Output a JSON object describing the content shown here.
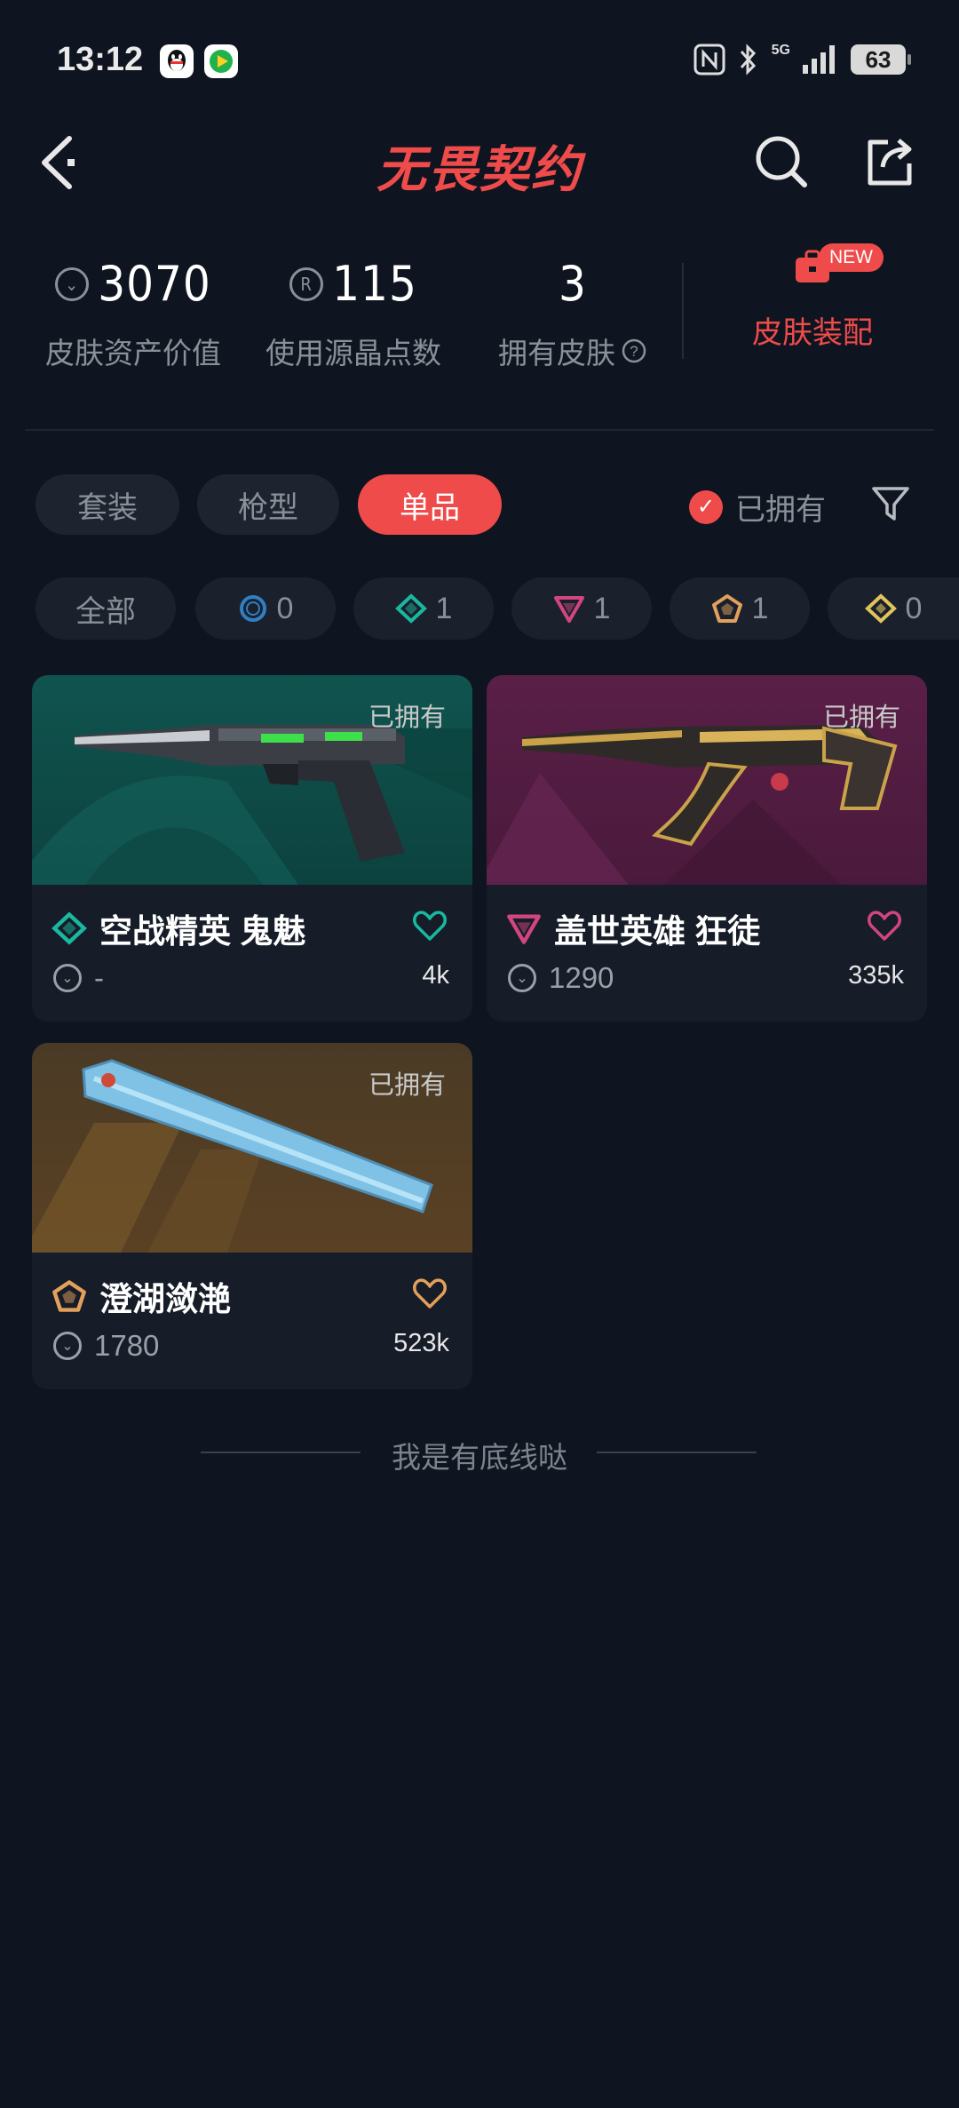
{
  "status_bar": {
    "time": "13:12",
    "net": "5G",
    "battery": "63"
  },
  "header": {
    "logo": "无畏契约"
  },
  "stats": [
    {
      "value": "3070",
      "label": "皮肤资产价值",
      "icon": "vp-coin-icon"
    },
    {
      "value": "115",
      "label": "使用源晶点数",
      "icon": "radianite-icon"
    },
    {
      "value": "3",
      "label": "拥有皮肤",
      "icon": "help-icon"
    }
  ],
  "equip": {
    "label": "皮肤装配",
    "badge": "NEW"
  },
  "tabs": [
    {
      "label": "套装",
      "active": false
    },
    {
      "label": "枪型",
      "active": false
    },
    {
      "label": "单品",
      "active": true
    }
  ],
  "owned_filter": {
    "label": "已拥有",
    "checked": true
  },
  "rarity_chips": [
    {
      "label": "全部"
    },
    {
      "count": "0",
      "color": "#2f7fc5"
    },
    {
      "count": "1",
      "color": "#1ab8a0"
    },
    {
      "count": "1",
      "color": "#d2457f"
    },
    {
      "count": "1",
      "color": "#e3a05b"
    },
    {
      "count": "0",
      "color": "#e1c45a"
    }
  ],
  "cards": [
    {
      "name": "空战精英 鬼魅",
      "price": "-",
      "likes": "4k",
      "owned": "已拥有",
      "rarity_color": "#1ab8a0",
      "heart_color": "#1ab8a0"
    },
    {
      "name": "盖世英雄 狂徒",
      "price": "1290",
      "likes": "335k",
      "owned": "已拥有",
      "rarity_color": "#d2457f",
      "heart_color": "#d2457f"
    },
    {
      "name": "澄湖潋滟",
      "price": "1780",
      "likes": "523k",
      "owned": "已拥有",
      "rarity_color": "#e3a05b",
      "heart_color": "#e3a05b"
    }
  ],
  "footer": {
    "text": "我是有底线哒"
  }
}
